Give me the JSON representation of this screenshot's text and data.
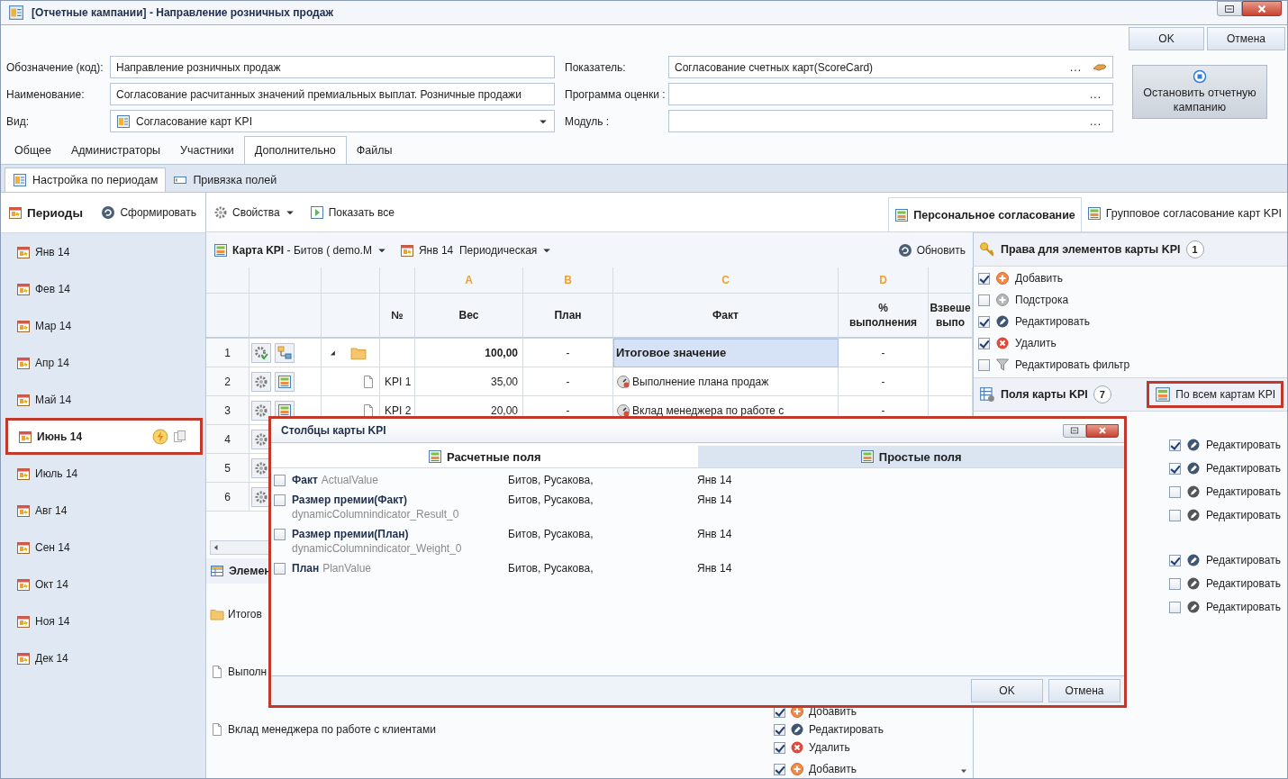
{
  "window": {
    "title": "[Отчетные кампании] - Направление розничных продаж"
  },
  "buttons": [
    {
      "label": "OK"
    },
    {
      "label": "Отмена"
    }
  ],
  "fields_left": [
    {
      "label": "Обозначение (код):",
      "value": "Направление розничных продаж",
      "kind": "text"
    },
    {
      "label": "Наименование:",
      "value": "Согласование расчитанных значений премиальных выплат. Розничные продажи",
      "kind": "text"
    },
    {
      "label": "Вид:",
      "value": "Согласование карт KPI",
      "kind": "dropdown"
    }
  ],
  "fields_right": [
    {
      "label": "Показатель:",
      "value": "Согласование счетных карт(ScoreCard)",
      "button": "...",
      "kind": "lookup-hand"
    },
    {
      "label": "Программа оценки :",
      "button": "...",
      "kind": "lookup"
    },
    {
      "label": "Модуль :",
      "button": "...",
      "kind": "lookup"
    }
  ],
  "stop_button": {
    "label": "Остановить отчетную кампанию"
  },
  "tabs": [
    {
      "label": "Общее",
      "selected": false
    },
    {
      "label": "Администраторы",
      "selected": false
    },
    {
      "label": "Участники",
      "selected": false
    },
    {
      "label": "Дополнительно",
      "selected": true
    },
    {
      "label": "Файлы",
      "selected": false
    }
  ],
  "subtabs": [
    {
      "label": "Настройка по периодам",
      "selected": true,
      "kind": "settings"
    },
    {
      "label": "Привязка полей",
      "selected": false,
      "kind": "binding"
    }
  ],
  "periods": {
    "title": "Периоды",
    "action": "Сформировать",
    "items": [
      {
        "label": "Янв 14",
        "selected": false
      },
      {
        "label": "Фев 14",
        "selected": false
      },
      {
        "label": "Мар 14",
        "selected": false
      },
      {
        "label": "Апр 14",
        "selected": false
      },
      {
        "label": "Май 14",
        "selected": false
      },
      {
        "label": "Июнь 14",
        "selected": true
      },
      {
        "label": "Июль 14",
        "selected": false
      },
      {
        "label": "Авг 14",
        "selected": false
      },
      {
        "label": "Сен 14",
        "selected": false
      },
      {
        "label": "Окт 14",
        "selected": false
      },
      {
        "label": "Ноя 14",
        "selected": false
      },
      {
        "label": "Дек 14",
        "selected": false
      }
    ]
  },
  "toolbar": [
    {
      "label": "Свойства",
      "kind": "dropdown"
    },
    {
      "label": "Показать все",
      "kind": "button"
    }
  ],
  "approval_tabs": [
    {
      "label": "Персональное согласование",
      "selected": true
    },
    {
      "label": "Групповое согласование карт KPI",
      "selected": false
    }
  ],
  "kpi_bar": {
    "card": "**Карта KPI** - Битов ( demo.M",
    "period": "Янв 14  Периодическая",
    "refresh": "Обновить"
  },
  "grid": {
    "columns": [
      {
        "header": "№"
      },
      {
        "letter": "A",
        "header": "Вес"
      },
      {
        "letter": "B",
        "header": "План"
      },
      {
        "letter": "C",
        "header": "Факт"
      },
      {
        "letter": "D",
        "header": "% выполнения"
      },
      {
        "header": "Взвеше\nвыпо"
      }
    ],
    "rows": [
      {
        "num": "1",
        "kind": "group",
        "expanded": true,
        "weight": "100,00",
        "plan": "-",
        "fact": "Итоговое значение",
        "percent": "-"
      },
      {
        "num": "2",
        "kind": "item",
        "code": "KPI 1",
        "weight": "35,00",
        "plan": "-",
        "fact": "Выполнение плана продаж",
        "percent": "-"
      },
      {
        "num": "3",
        "kind": "item",
        "code": "KPI 2",
        "weight": "20,00",
        "plan": "-",
        "fact": "Вклад менеджера по работе с",
        "percent": "-"
      },
      {
        "num": "4",
        "kind": "item"
      },
      {
        "num": "5",
        "kind": "item"
      },
      {
        "num": "6",
        "kind": "item"
      }
    ]
  },
  "elements": {
    "title": "Элемен",
    "items": [
      {
        "kind": "folder",
        "label": "Итогов"
      },
      {
        "kind": "doc",
        "label": "Выполн"
      },
      {
        "kind": "doc",
        "label": "Вклад менеджера по работе с клиентами",
        "perms": [
          {
            "kind": "add",
            "label": "Добавить",
            "checked": true
          },
          {
            "kind": "edit",
            "label": "Редактировать",
            "checked": true
          },
          {
            "kind": "delete",
            "label": "Удалить",
            "checked": true
          }
        ]
      },
      {
        "perms": [
          {
            "kind": "add",
            "label": "Добавить",
            "checked": true
          }
        ]
      }
    ]
  },
  "rights": {
    "title": "Права для элементов карты KPI",
    "count": "1",
    "items": [
      {
        "kind": "add",
        "label": "Добавить",
        "checked": true
      },
      {
        "kind": "subrow",
        "label": "Подстрока",
        "checked": false
      },
      {
        "kind": "edit",
        "label": "Редактировать",
        "checked": true
      },
      {
        "kind": "delete",
        "label": "Удалить",
        "checked": true
      },
      {
        "kind": "filter",
        "label": "Редактировать фильтр",
        "checked": false
      }
    ]
  },
  "fields_panel": {
    "title": "Поля карты KPI",
    "count": "7",
    "button": "По всем картам KPI",
    "highlighted": true,
    "groups": [
      [
        {
          "label": "Редактировать",
          "checked": true
        },
        {
          "label": "Редактировать",
          "checked": true
        },
        {
          "label": "Редактировать",
          "checked": false
        },
        {
          "label": "Редактировать",
          "checked": false
        }
      ],
      [
        {
          "label": "Редактировать",
          "checked": true
        },
        {
          "label": "Редактировать",
          "checked": false
        },
        {
          "label": "Редактировать",
          "checked": false
        }
      ]
    ]
  },
  "dialog": {
    "title": "Столбцы карты KPI",
    "highlighted": true,
    "tabs": [
      {
        "label": "Расчетные поля",
        "selected": true
      },
      {
        "label": "Простые поля",
        "selected": false
      }
    ],
    "rows": [
      {
        "name": "Факт",
        "code": "ActualValue",
        "kind": "inline",
        "users": "Битов, Русакова,",
        "period": "Янв 14",
        "checked": false
      },
      {
        "name": "Размер премии(Факт)",
        "code": "dynamicColumnindicator_Result_0",
        "kind": "stacked",
        "users": "Битов, Русакова,",
        "period": "Янв 14",
        "checked": false
      },
      {
        "name": "Размер премии(План)",
        "code": "dynamicColumnindicator_Weight_0",
        "kind": "stacked",
        "users": "Битов, Русакова,",
        "period": "Янв 14",
        "checked": false
      },
      {
        "name": "План",
        "code": "PlanValue",
        "kind": "inline",
        "users": "Битов, Русакова,",
        "period": "Янв 14",
        "checked": false
      }
    ],
    "buttons": [
      {
        "label": "OK"
      },
      {
        "label": "Отмена"
      }
    ]
  }
}
